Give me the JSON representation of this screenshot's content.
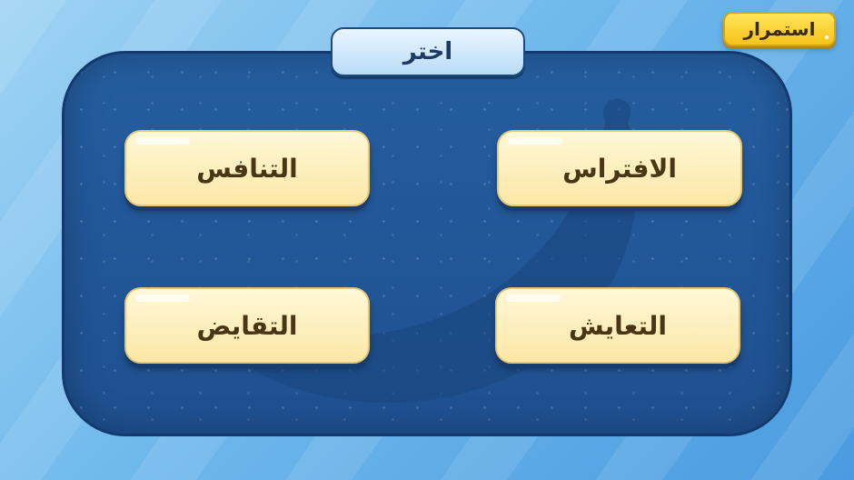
{
  "continue_button": {
    "label": "استمرار"
  },
  "title": "اختر",
  "options": [
    {
      "label": "الافتراس"
    },
    {
      "label": "التنافس"
    },
    {
      "label": "التعايش"
    },
    {
      "label": "التقايض"
    }
  ],
  "colors": {
    "panel": "#1f5090",
    "option_face": "#fbe7a6",
    "continue_face": "#f6c21a",
    "title_tab": "#b8dcf6"
  },
  "icons": [
    "banana-silhouette"
  ]
}
